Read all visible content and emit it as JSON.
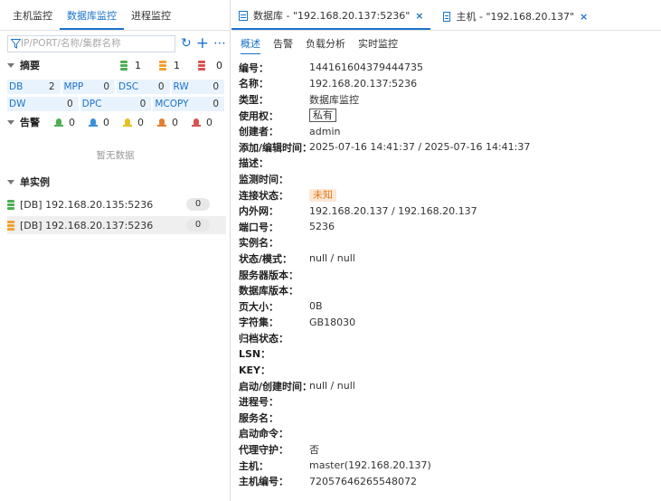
{
  "left": {
    "tabs": [
      "主机监控",
      "数据库监控",
      "进程监控"
    ],
    "search_placeholder": "IP/PORT/名称/集群名称",
    "summary": {
      "title": "摘要",
      "counts": [
        {
          "value": "1",
          "color": "#4caf50"
        },
        {
          "value": "1",
          "color": "#f5a030"
        },
        {
          "value": "0",
          "color": "#d9534f"
        }
      ],
      "grid": [
        [
          {
            "label": "DB",
            "value": "2"
          },
          {
            "label": "MPP",
            "value": "0"
          },
          {
            "label": "DSC",
            "value": "0"
          },
          {
            "label": "RW",
            "value": "0"
          }
        ],
        [
          {
            "label": "DW",
            "value": "0"
          },
          {
            "label": "DPC",
            "value": "0"
          },
          {
            "label": "MCOPY",
            "value": "0"
          }
        ]
      ]
    },
    "alarm": {
      "title": "告警",
      "counts": [
        {
          "value": "0",
          "color": "#4caf50"
        },
        {
          "value": "0",
          "color": "#3a8fd8"
        },
        {
          "value": "0",
          "color": "#e6c020"
        },
        {
          "value": "0",
          "color": "#e08030"
        },
        {
          "value": "0",
          "color": "#d9534f"
        }
      ],
      "empty_text": "暂无数据"
    },
    "instances": {
      "title": "单实例",
      "items": [
        {
          "label": "[DB] 192.168.20.135:5236",
          "count": "0",
          "color": "#4caf50"
        },
        {
          "label": "[DB] 192.168.20.137:5236",
          "count": "0",
          "color": "#f5a030"
        }
      ]
    }
  },
  "right": {
    "doc_tabs": [
      {
        "label": "数据库 - \"192.168.20.137:5236\"",
        "close": "×"
      },
      {
        "label": "主机 - \"192.168.20.137\"",
        "close": "×"
      }
    ],
    "sub_tabs": [
      "概述",
      "告警",
      "负载分析",
      "实时监控"
    ],
    "props": [
      {
        "k": "编号：",
        "v": "144161604379444735"
      },
      {
        "k": "名称：",
        "v": "192.168.20.137:5236"
      },
      {
        "k": "类型：",
        "v": "数据库监控"
      },
      {
        "k": "使用权：",
        "v": "私有"
      },
      {
        "k": "创建者：",
        "v": "admin"
      },
      {
        "k": "添加/编辑时间：",
        "v": "2025-07-16 14:41:37 / 2025-07-16 14:41:37"
      },
      {
        "k": "描述：",
        "v": ""
      },
      {
        "k": "监测时间：",
        "v": ""
      },
      {
        "k": "连接状态：",
        "v": "未知"
      },
      {
        "k": "内外网：",
        "v": "192.168.20.137 / 192.168.20.137"
      },
      {
        "k": "端口号：",
        "v": "5236"
      },
      {
        "k": "实例名：",
        "v": ""
      },
      {
        "k": "状态/模式：",
        "v": "null / null"
      },
      {
        "k": "服务器版本：",
        "v": ""
      },
      {
        "k": "数据库版本：",
        "v": ""
      },
      {
        "k": "页大小：",
        "v": "0B"
      },
      {
        "k": "字符集：",
        "v": "GB18030"
      },
      {
        "k": "归档状态：",
        "v": ""
      },
      {
        "k": "LSN：",
        "v": ""
      },
      {
        "k": "KEY：",
        "v": ""
      },
      {
        "k": "启动/创建时间：",
        "v": "null / null"
      },
      {
        "k": "进程号：",
        "v": ""
      },
      {
        "k": "服务名：",
        "v": ""
      },
      {
        "k": "启动命令：",
        "v": ""
      },
      {
        "k": "代理守护：",
        "v": "否"
      },
      {
        "k": "主机：",
        "v": "master(192.168.20.137)"
      },
      {
        "k": "主机编号：",
        "v": "72057646265548072"
      }
    ]
  }
}
